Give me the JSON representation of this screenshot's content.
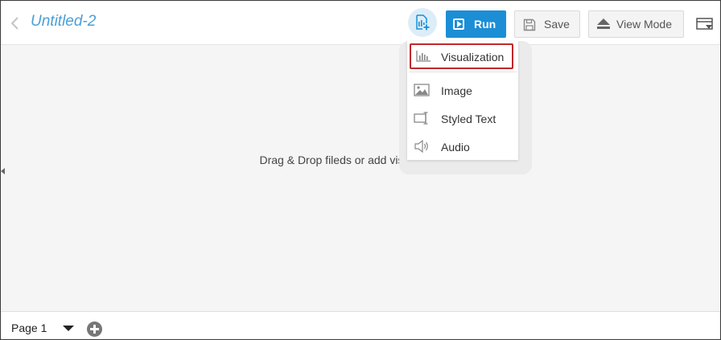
{
  "header": {
    "title": "Untitled-2",
    "run_label": "Run",
    "save_label": "Save",
    "view_mode_label": "View Mode",
    "icons": [
      "chevron-left-icon",
      "add-visualization-icon",
      "run-icon",
      "save-icon",
      "eject-icon",
      "preview-icon"
    ],
    "accent_color": "#1b8ed6",
    "title_color": "#4a9fd5"
  },
  "insert_menu": {
    "items": [
      {
        "label": "Visualization",
        "icon": "bar-chart-icon",
        "selected": true
      },
      {
        "label": "Image",
        "icon": "image-icon",
        "selected": false
      },
      {
        "label": "Styled Text",
        "icon": "styled-text-icon",
        "selected": false
      },
      {
        "label": "Audio",
        "icon": "audio-icon",
        "selected": false
      }
    ],
    "highlight_color": "#c0282a"
  },
  "canvas": {
    "hint": "Drag & Drop fileds or add visualizations here"
  },
  "footer": {
    "page_label": "Page 1"
  }
}
